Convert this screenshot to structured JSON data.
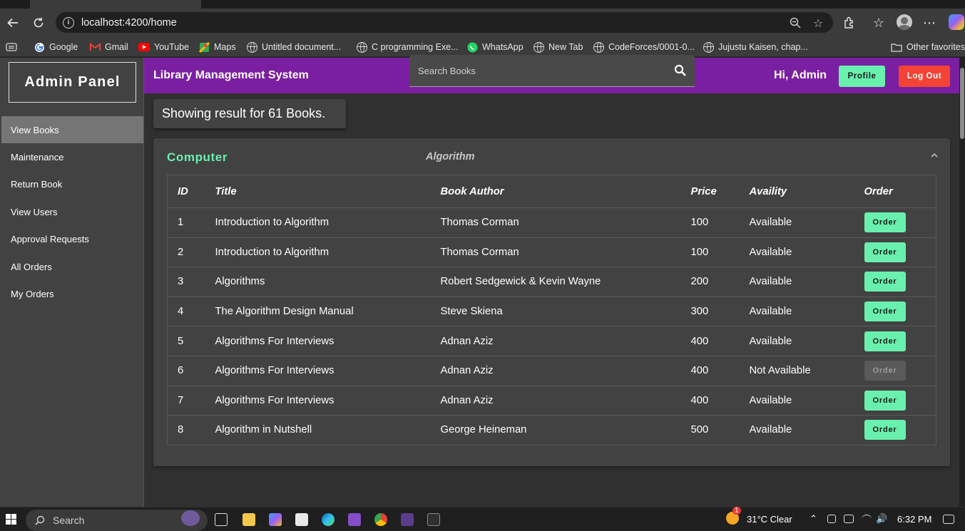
{
  "browser": {
    "url": "localhost:4200/home",
    "icons": [
      "back-arrow-icon",
      "refresh-icon",
      "info-icon",
      "zoom-icon",
      "favorite-star-icon",
      "extensions-icon",
      "favorites-icon",
      "profile-avatar-icon",
      "more-icon",
      "copilot-icon"
    ],
    "bookmarks": [
      {
        "label": "Google",
        "icon": "google-icon"
      },
      {
        "label": "Gmail",
        "icon": "gmail-icon"
      },
      {
        "label": "YouTube",
        "icon": "youtube-icon"
      },
      {
        "label": "Maps",
        "icon": "maps-icon"
      },
      {
        "label": "Untitled document...",
        "icon": "globe-icon"
      },
      {
        "label": "C programming Exe...",
        "icon": "globe-icon"
      },
      {
        "label": "WhatsApp",
        "icon": "whatsapp-icon"
      },
      {
        "label": "New Tab",
        "icon": "globe-icon"
      },
      {
        "label": "CodeForces/0001-0...",
        "icon": "globe-icon"
      },
      {
        "label": "Jujustu Kaisen, chap...",
        "icon": "globe-icon"
      }
    ],
    "other_favorites": "Other favorites"
  },
  "sidebar": {
    "brand": "Admin Panel",
    "items": [
      {
        "label": "View Books",
        "active": true
      },
      {
        "label": "Maintenance"
      },
      {
        "label": "Return Book"
      },
      {
        "label": "View Users"
      },
      {
        "label": "Approval Requests"
      },
      {
        "label": "All Orders"
      },
      {
        "label": "My Orders"
      }
    ]
  },
  "header": {
    "title": "Library Management System",
    "greeting": "Hi, Admin",
    "profile_label": "Profile",
    "logout_label": "Log Out",
    "colors": {
      "bar": "#7b1fa2",
      "profile": "#69f0ae",
      "logout": "#f44336"
    }
  },
  "search": {
    "placeholder": "Search Books",
    "icon": "search-icon"
  },
  "result_text": "Showing result for 61 Books.",
  "panel": {
    "category": "Computer",
    "subcategory": "Algorithm",
    "expanded": true,
    "accent": "#69f0ae",
    "columns": [
      "ID",
      "Title",
      "Book Author",
      "Price",
      "Availity",
      "Order"
    ],
    "order_label": "Order",
    "rows": [
      {
        "id": "1",
        "title": "Introduction to Algorithm",
        "author": "Thomas Corman",
        "price": "100",
        "status": "Available",
        "enabled": true
      },
      {
        "id": "2",
        "title": "Introduction to Algorithm",
        "author": "Thomas Corman",
        "price": "100",
        "status": "Available",
        "enabled": true
      },
      {
        "id": "3",
        "title": "Algorithms",
        "author": "Robert Sedgewick & Kevin Wayne",
        "price": "200",
        "status": "Available",
        "enabled": true
      },
      {
        "id": "4",
        "title": "The Algorithm Design Manual",
        "author": "Steve Skiena",
        "price": "300",
        "status": "Available",
        "enabled": true
      },
      {
        "id": "5",
        "title": "Algorithms For Interviews",
        "author": "Adnan Aziz",
        "price": "400",
        "status": "Available",
        "enabled": true
      },
      {
        "id": "6",
        "title": "Algorithms For Interviews",
        "author": "Adnan Aziz",
        "price": "400",
        "status": "Not Available",
        "enabled": false
      },
      {
        "id": "7",
        "title": "Algorithms For Interviews",
        "author": "Adnan Aziz",
        "price": "400",
        "status": "Available",
        "enabled": true
      },
      {
        "id": "8",
        "title": "Algorithm in Nutshell",
        "author": "George Heineman",
        "price": "500",
        "status": "Available",
        "enabled": true
      }
    ]
  },
  "taskbar": {
    "search_label": "Search",
    "weather": "31°C  Clear",
    "time": "6:32 PM",
    "notification_badge": "1"
  }
}
